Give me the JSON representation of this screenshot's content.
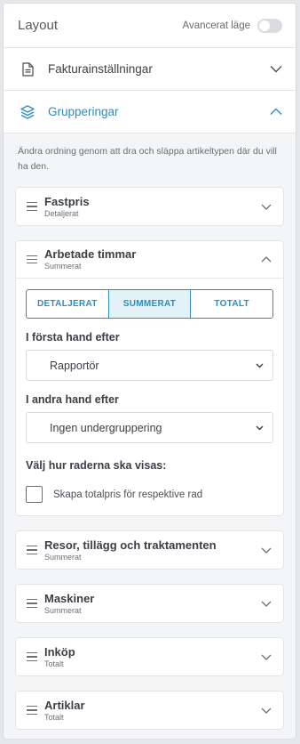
{
  "header": {
    "title": "Layout",
    "advanced_label": "Avancerat läge",
    "advanced_on": false
  },
  "sections": [
    {
      "label": "Fakturainställningar",
      "icon": "document-icon",
      "expanded": false
    },
    {
      "label": "Grupperingar",
      "icon": "layers-icon",
      "expanded": true
    }
  ],
  "groupings": {
    "intro": "Ändra ordning genom att dra och släppa artikeltypen där du vill ha den.",
    "cards": [
      {
        "title": "Fastpris",
        "subtitle": "Detaljerat"
      },
      {
        "title": "Arbetade timmar",
        "subtitle": "Summerat"
      },
      {
        "title": "Resor, tillägg och traktamenten",
        "subtitle": "Summerat"
      },
      {
        "title": "Maskiner",
        "subtitle": "Summerat"
      },
      {
        "title": "Inköp",
        "subtitle": "Totalt"
      },
      {
        "title": "Artiklar",
        "subtitle": "Totalt"
      }
    ],
    "detail": {
      "segments": [
        "DETALJERAT",
        "SUMMERAT",
        "TOTALT"
      ],
      "selected_segment": "SUMMERAT",
      "first_label": "I första hand efter",
      "first_value": "Rapportör",
      "second_label": "I andra hand efter",
      "second_value": "Ingen undergruppering",
      "rows_label": "Välj hur raderna ska visas:",
      "checkbox_label": "Skapa totalpris för respektive rad",
      "checkbox_checked": false
    }
  },
  "colors": {
    "accent": "#2a8ec2",
    "accent_bg": "#e3f1f9",
    "panel_bg": "#f4f5f7"
  }
}
